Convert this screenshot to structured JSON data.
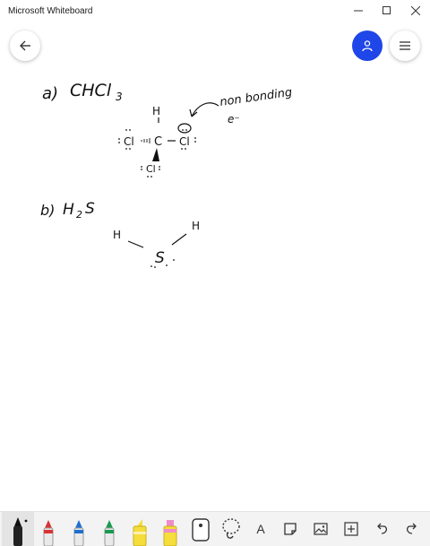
{
  "window": {
    "title": "Microsoft Whiteboard"
  },
  "canvas": {
    "note_a_label": "a)",
    "note_a_formula": "CHCl",
    "note_a_subscript": "3",
    "annotation_line1": "non bonding",
    "annotation_line2": "e⁻",
    "atom_H": "H",
    "atom_C": "C",
    "atom_Cl_left": "Cl",
    "atom_Cl_right": "Cl",
    "atom_Cl_bottom": "Cl",
    "note_b_label": "b)",
    "note_b_formula_H": "H",
    "note_b_subscript": "2",
    "note_b_formula_S": "S",
    "h2s_H_left": "H",
    "h2s_H_right": "H",
    "h2s_S": "S"
  },
  "toolbar": {
    "text_tool_label": "A",
    "pens": [
      {
        "name": "black",
        "color": "#111111"
      },
      {
        "name": "red",
        "color": "#d83333"
      },
      {
        "name": "blue",
        "color": "#1f6fd0"
      },
      {
        "name": "green",
        "color": "#1a9a50"
      },
      {
        "name": "yellow-highlighter",
        "color": "#f5dd3b"
      },
      {
        "name": "pink-highlighter",
        "color": "#f08cc8"
      }
    ]
  },
  "colors": {
    "accent": "#1f46e8",
    "ink": "#111111"
  }
}
